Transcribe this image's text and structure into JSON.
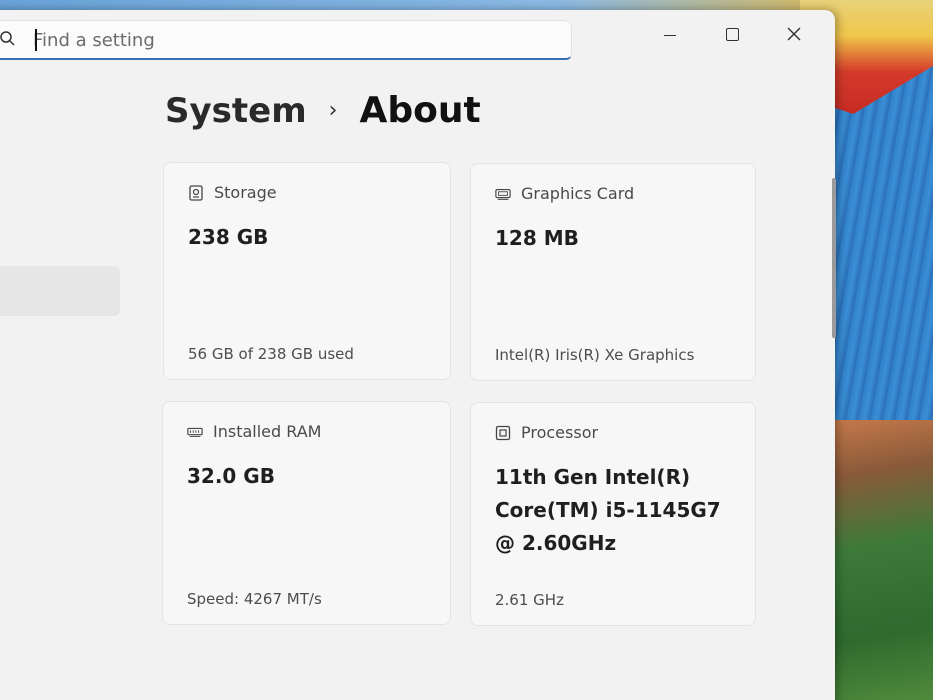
{
  "search": {
    "placeholder": "Find a setting"
  },
  "window_controls": {
    "minimize": "minimize",
    "maximize": "maximize",
    "close": "close"
  },
  "breadcrumb": {
    "parent": "System",
    "separator": "›",
    "current": "About"
  },
  "cards": {
    "storage": {
      "icon": "storage-icon",
      "title": "Storage",
      "value": "238 GB",
      "detail": "56 GB of 238 GB used"
    },
    "graphics": {
      "icon": "graphics-card-icon",
      "title": "Graphics Card",
      "value": "128 MB",
      "detail": "Intel(R) Iris(R) Xe Graphics"
    },
    "ram": {
      "icon": "ram-icon",
      "title": "Installed RAM",
      "value": "32.0 GB",
      "detail": "Speed: 4267 MT/s"
    },
    "processor": {
      "icon": "processor-icon",
      "title": "Processor",
      "value": "11th Gen Intel(R) Core(TM) i5-1145G7 @ 2.60GHz",
      "detail": "2.61 GHz"
    }
  },
  "colors": {
    "accent": "#3a6fb8",
    "window_bg": "#f2f2f3",
    "card_bg": "#f7f7f8"
  }
}
